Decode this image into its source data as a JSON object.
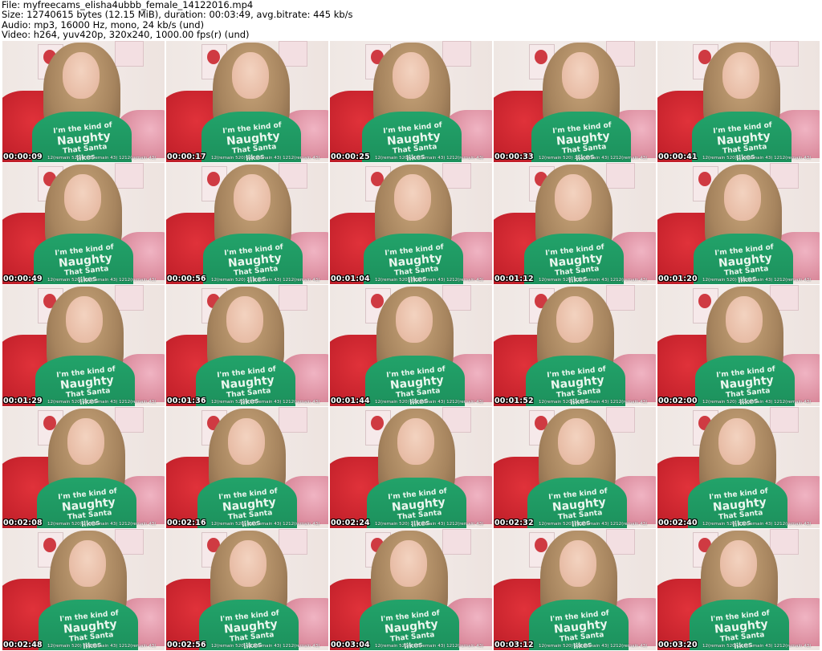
{
  "header": {
    "file": "File: myfreecams_elisha4ubbb_female_14122016.mp4",
    "size": "Size: 12740615 bytes (12.15 MiB), duration: 00:03:49, avg.bitrate: 445 kb/s",
    "audio": "Audio: mp3, 16000 Hz, mono, 24 kb/s (und)",
    "video": "Video: h264, yuv420p, 320x240, 1000.00 fps(r) (und)"
  },
  "overlay_text": "12(remain 520) 212(remain 43) 1212(remain 43)",
  "shirt_print": {
    "line1": "I'm the kind of",
    "line2": "Naughty",
    "line3": "That Santa likes"
  },
  "thumbnails": [
    {
      "timestamp": "00:00:09"
    },
    {
      "timestamp": "00:00:17"
    },
    {
      "timestamp": "00:00:25"
    },
    {
      "timestamp": "00:00:33"
    },
    {
      "timestamp": "00:00:41"
    },
    {
      "timestamp": "00:00:49"
    },
    {
      "timestamp": "00:00:56"
    },
    {
      "timestamp": "00:01:04"
    },
    {
      "timestamp": "00:01:12"
    },
    {
      "timestamp": "00:01:20"
    },
    {
      "timestamp": "00:01:29"
    },
    {
      "timestamp": "00:01:36"
    },
    {
      "timestamp": "00:01:44"
    },
    {
      "timestamp": "00:01:52"
    },
    {
      "timestamp": "00:02:00"
    },
    {
      "timestamp": "00:02:08"
    },
    {
      "timestamp": "00:02:16"
    },
    {
      "timestamp": "00:02:24"
    },
    {
      "timestamp": "00:02:32"
    },
    {
      "timestamp": "00:02:40"
    },
    {
      "timestamp": "00:02:48"
    },
    {
      "timestamp": "00:02:56"
    },
    {
      "timestamp": "00:03:04"
    },
    {
      "timestamp": "00:03:12"
    },
    {
      "timestamp": "00:03:20"
    }
  ]
}
